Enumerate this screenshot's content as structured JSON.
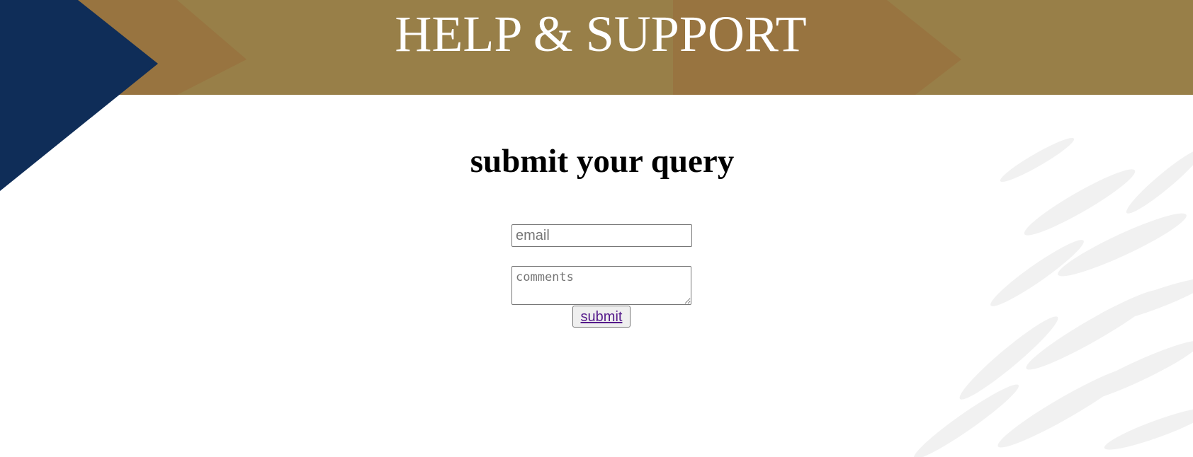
{
  "header": {
    "title": "HELP & SUPPORT"
  },
  "form": {
    "heading": "submit your query",
    "email_placeholder": "email",
    "comments_placeholder": "comments",
    "submit_label": "submit"
  },
  "colors": {
    "banner_gold": "#987f48",
    "chevron_brown": "#98723f",
    "navy": "#0f2d58",
    "link_purple": "#551a8b"
  },
  "icons": {
    "resize_handle": "resize-grip-icon"
  }
}
